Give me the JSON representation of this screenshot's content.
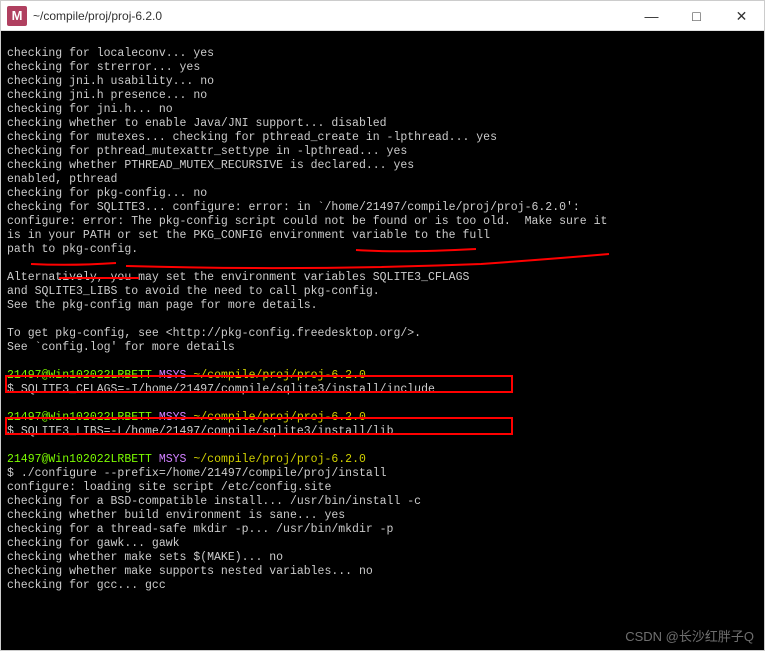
{
  "window": {
    "icon_letter": "M",
    "title": "~/compile/proj/proj-6.2.0",
    "controls": {
      "min": "—",
      "max": "□",
      "close": "✕"
    }
  },
  "prompt": {
    "user": "21497@Win102022LRBETT",
    "system": "MSYS",
    "path": "~/compile/proj/proj-6.2.0",
    "symbol": "$"
  },
  "commands": {
    "cflags": "SQLITE3_CFLAGS=-I/home/21497/compile/sqlite3/install/include",
    "libs": "SQLITE3_LIBS=-L/home/21497/compile/sqlite3/install/lib",
    "configure": "./configure --prefix=/home/21497/compile/proj/install"
  },
  "lines": {
    "l1": "checking for localeconv... yes",
    "l2": "checking for strerror... yes",
    "l3": "checking jni.h usability... no",
    "l4": "checking jni.h presence... no",
    "l5": "checking for jni.h... no",
    "l6": "checking whether to enable Java/JNI support... disabled",
    "l7": "checking for mutexes... checking for pthread_create in -lpthread... yes",
    "l8": "checking for pthread_mutexattr_settype in -lpthread... yes",
    "l9": "checking whether PTHREAD_MUTEX_RECURSIVE is declared... yes",
    "l10": "enabled, pthread",
    "l11": "checking for pkg-config... no",
    "l12": "checking for SQLITE3... configure: error: in `/home/21497/compile/proj/proj-6.2.0':",
    "l13": "configure: error: The pkg-config script could not be found or is too old.  Make sure it",
    "l14": "is in your PATH or set the PKG_CONFIG environment variable to the full",
    "l15": "path to pkg-config.",
    "l17": "Alternatively, you may set the environment variables SQLITE3_CFLAGS",
    "l18": "and SQLITE3_LIBS to avoid the need to call pkg-config.",
    "l19": "See the pkg-config man page for more details.",
    "l21": "To get pkg-config, see <http://pkg-config.freedesktop.org/>.",
    "l22": "See `config.log' for more details",
    "c1": "configure: loading site script /etc/config.site",
    "c2": "checking for a BSD-compatible install... /usr/bin/install -c",
    "c3": "checking whether build environment is sane... yes",
    "c4": "checking for a thread-safe mkdir -p... /usr/bin/mkdir -p",
    "c5": "checking for gawk... gawk",
    "c6": "checking whether make sets $(MAKE)... no",
    "c7": "checking whether make supports nested variables... no",
    "c8": "checking for gcc... gcc"
  },
  "watermark": "CSDN @长沙红胖子Q"
}
